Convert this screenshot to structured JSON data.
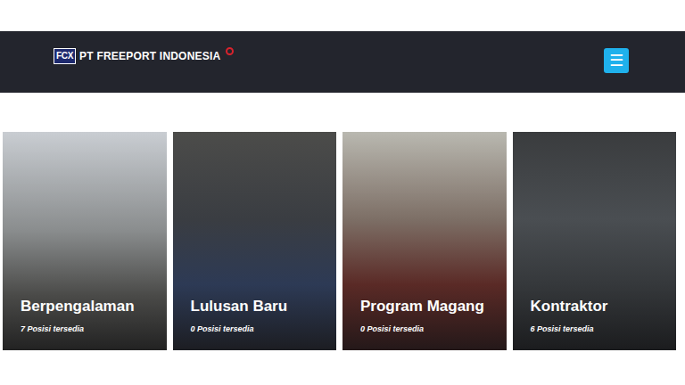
{
  "header": {
    "logo_mark": "FCX",
    "logo_text": "PT FREEPORT INDONESIA",
    "menu_icon": "☰"
  },
  "cards": [
    {
      "title": "Berpengalaman",
      "count": "7 Posisi tersedia"
    },
    {
      "title": "Lulusan Baru",
      "count": "0 Posisi tersedia"
    },
    {
      "title": "Program Magang",
      "count": "0 Posisi tersedia"
    },
    {
      "title": "Kontraktor",
      "count": "6 Posisi tersedia"
    }
  ]
}
